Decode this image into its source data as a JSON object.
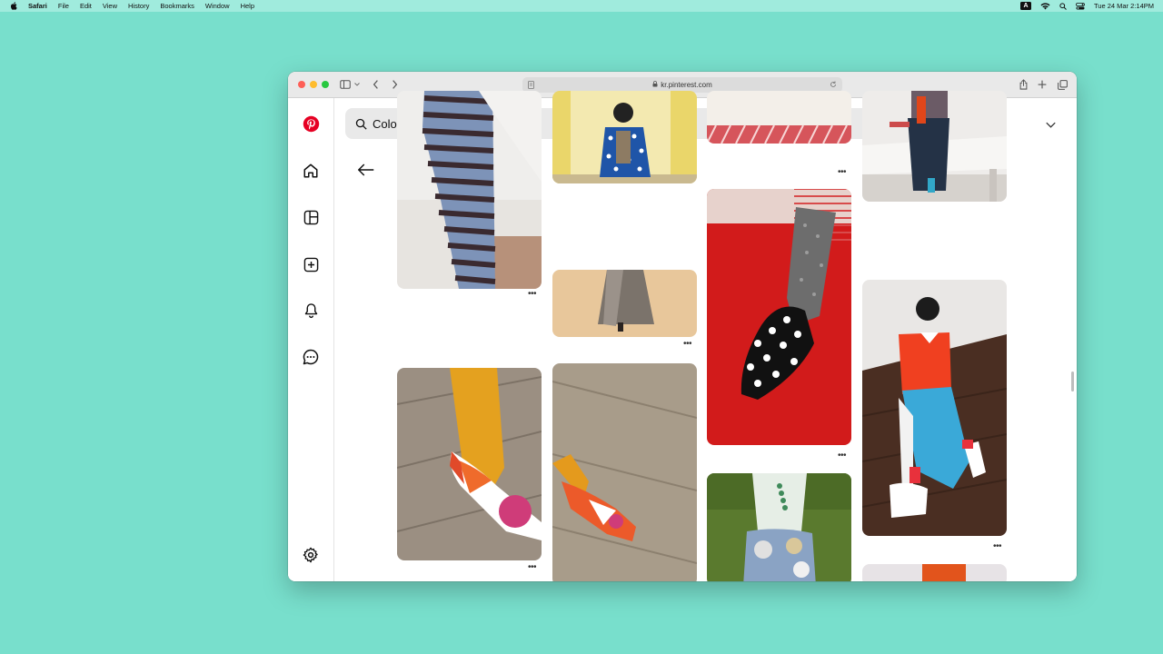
{
  "menubar": {
    "items": [
      "Safari",
      "File",
      "Edit",
      "View",
      "History",
      "Bookmarks",
      "Window",
      "Help"
    ],
    "input_badge": "A",
    "datetime": "Tue 24 Mar  2:14PM"
  },
  "browser": {
    "address": "kr.pinterest.com"
  },
  "search": {
    "query": "Color Styling"
  },
  "colors": {
    "pinterest_red": "#e60023",
    "desktop": "#78dfcc"
  },
  "icons": {
    "sidebar": [
      "pinterest-logo",
      "home-icon",
      "board-icon",
      "create-icon",
      "notifications-icon",
      "messages-icon",
      "settings-icon"
    ]
  },
  "pins": [
    {
      "name": "pin-striped-tights",
      "palette": "blue-brown-stripes"
    },
    {
      "name": "pin-polka-blouse",
      "palette": "blue-yellow"
    },
    {
      "name": "pin-grey-skirt",
      "palette": "beige-grey"
    },
    {
      "name": "pin-red-stripe-top",
      "palette": "red-white"
    },
    {
      "name": "pin-polka-shoe-red-carpet",
      "palette": "red-black-white"
    },
    {
      "name": "pin-bench-outfit",
      "palette": "grey-white"
    },
    {
      "name": "pin-red-top-blue-skirt",
      "palette": "red-blue-brown"
    },
    {
      "name": "pin-yellow-tights-shoe",
      "palette": "yellow-orange-pink"
    },
    {
      "name": "pin-orange-flat-shoe",
      "palette": "yellow-orange"
    },
    {
      "name": "pin-garden-tray",
      "palette": "green-white"
    },
    {
      "name": "pin-orange-partial",
      "palette": "orange"
    }
  ]
}
